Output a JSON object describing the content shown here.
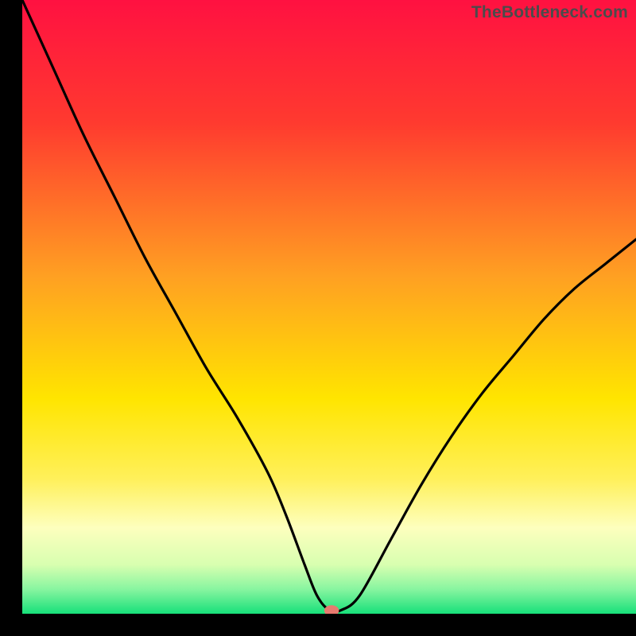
{
  "watermark": "TheBottleneck.com",
  "chart_data": {
    "type": "line",
    "title": "",
    "xlabel": "",
    "ylabel": "",
    "xlim": [
      0,
      100
    ],
    "ylim": [
      0,
      100
    ],
    "gradient_stops": [
      {
        "offset": 0,
        "color": "#ff1141"
      },
      {
        "offset": 20,
        "color": "#ff3a2f"
      },
      {
        "offset": 45,
        "color": "#ffa022"
      },
      {
        "offset": 65,
        "color": "#ffe500"
      },
      {
        "offset": 78,
        "color": "#fff05a"
      },
      {
        "offset": 86,
        "color": "#fdffbe"
      },
      {
        "offset": 92,
        "color": "#d8ffb0"
      },
      {
        "offset": 96,
        "color": "#88f5a0"
      },
      {
        "offset": 100,
        "color": "#17e07a"
      }
    ],
    "curve": {
      "name": "bottleneck-curve",
      "x": [
        0,
        5,
        10,
        15,
        20,
        25,
        30,
        35,
        40,
        43,
        46,
        48,
        50,
        52,
        55,
        60,
        65,
        70,
        75,
        80,
        85,
        90,
        95,
        100
      ],
      "y": [
        100,
        89,
        78,
        68,
        58,
        49,
        40,
        32,
        23,
        16,
        8,
        3,
        0.6,
        0.6,
        3,
        12,
        21,
        29,
        36,
        42,
        48,
        53,
        57,
        61
      ]
    },
    "flat_bottom": {
      "x_start": 48.6,
      "x_end": 52.4,
      "y": 0.6
    },
    "marker": {
      "x": 50.4,
      "y": 0.5,
      "rx": 1.2,
      "ry": 0.9,
      "color": "#e77a6f"
    }
  }
}
